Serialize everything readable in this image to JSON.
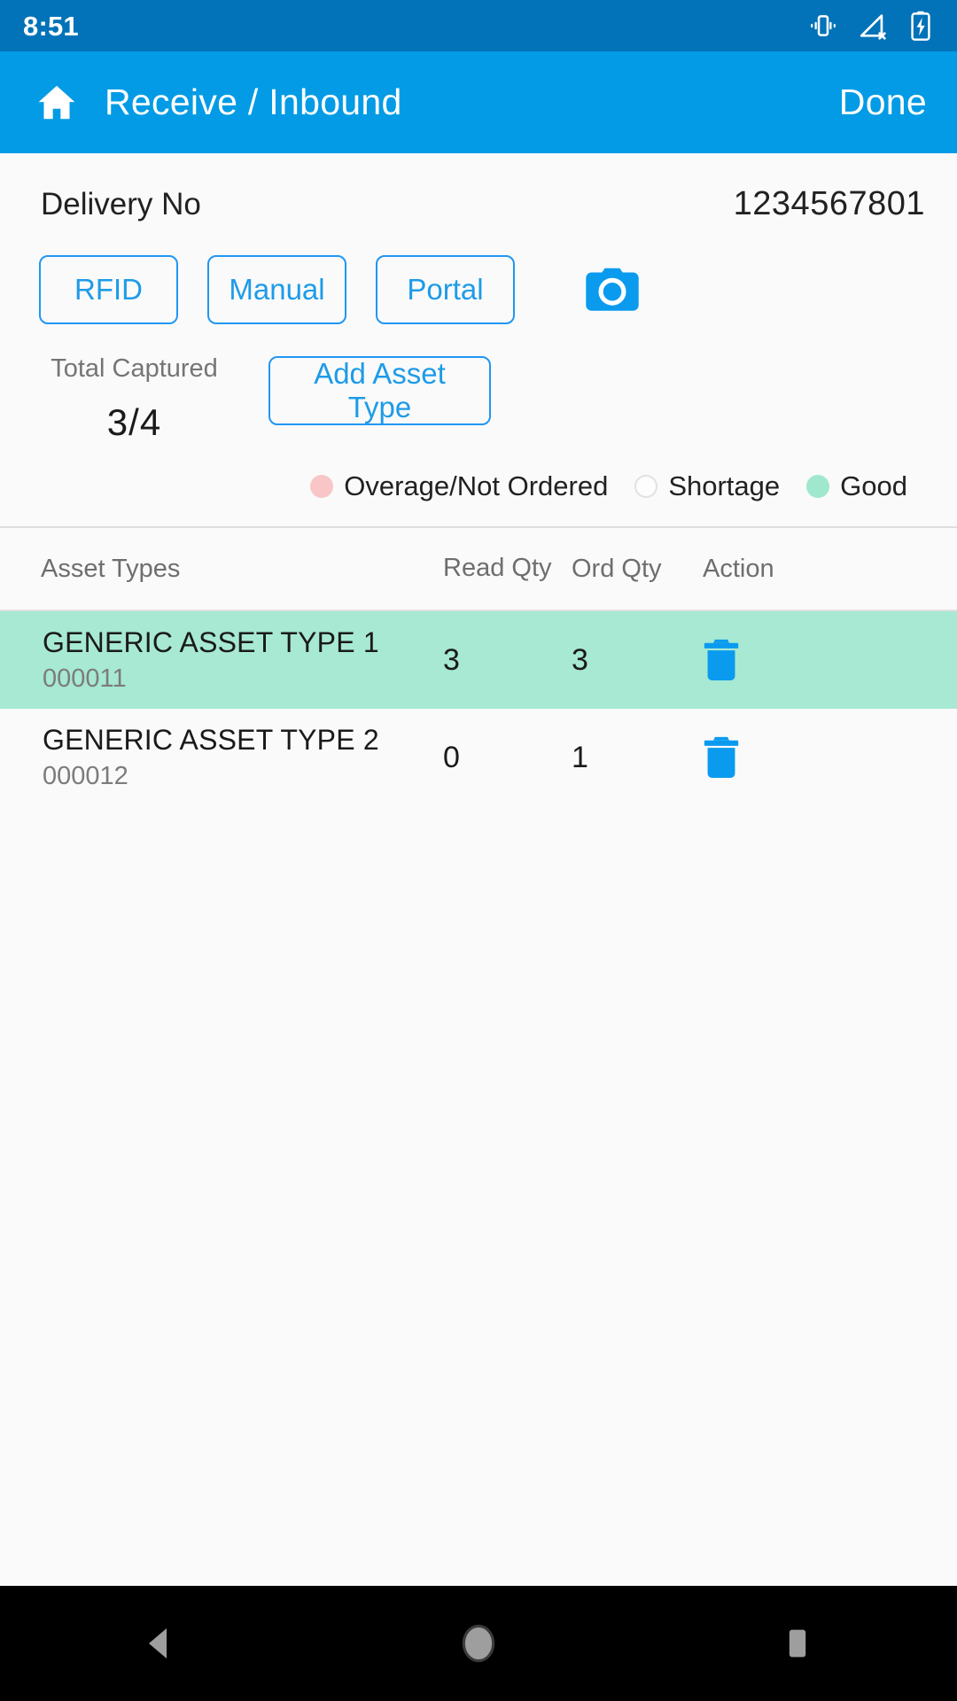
{
  "status_bar": {
    "time": "8:51",
    "icons": [
      "vibrate-icon",
      "no-signal-icon",
      "battery-charging-icon"
    ],
    "background": "#0273B8"
  },
  "app_bar": {
    "home_icon": "home-icon",
    "title": "Receive / Inbound",
    "action_label": "Done",
    "background": "#039BE5"
  },
  "delivery": {
    "label": "Delivery No",
    "value": "1234567801"
  },
  "capture_buttons": [
    {
      "label": "RFID"
    },
    {
      "label": "Manual"
    },
    {
      "label": "Portal"
    }
  ],
  "camera_icon": "camera-icon",
  "total_captured": {
    "label": "Total Captured",
    "value": "3/4"
  },
  "add_asset_type": {
    "label": "Add Asset Type"
  },
  "legend": [
    {
      "label": "Overage/Not Ordered",
      "color": "#F8C6C6",
      "style": "filled"
    },
    {
      "label": "Shortage",
      "color": "#FDFDFD",
      "style": "hollow"
    },
    {
      "label": "Good",
      "color": "#9FE8CE",
      "style": "filled"
    }
  ],
  "table": {
    "headers": {
      "name": "Asset Types",
      "read_qty": "Read Qty",
      "ord_qty": "Ord Qty",
      "action": "Action"
    },
    "rows": [
      {
        "name": "GENERIC ASSET TYPE 1",
        "code": "000011",
        "read_qty": "3",
        "ord_qty": "3",
        "status": "good",
        "row_color": "#A7E9D3",
        "action_icon": "trash-icon"
      },
      {
        "name": "GENERIC ASSET TYPE 2",
        "code": "000012",
        "read_qty": "0",
        "ord_qty": "1",
        "status": "none",
        "row_color": "#FAFAFA",
        "action_icon": "trash-icon"
      }
    ]
  },
  "nav_bar": {
    "back": "back-triangle-icon",
    "home": "home-circle-icon",
    "recents": "recents-square-icon"
  },
  "colors": {
    "accent": "#2196F3",
    "link": "#1E9BE8",
    "appbar": "#039BE5",
    "statusbar": "#0273B8",
    "good_row": "#A7E9D3"
  }
}
